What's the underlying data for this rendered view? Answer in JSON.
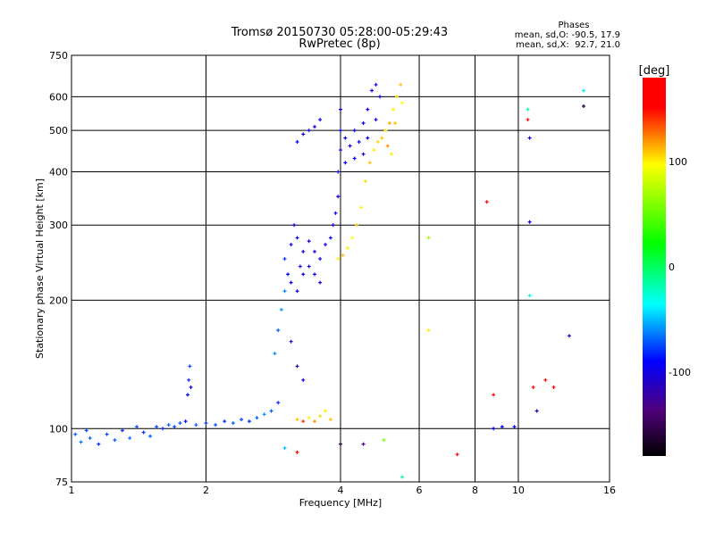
{
  "chart_data": {
    "type": "scatter",
    "title": "Tromsø 20150730 05:28:00-05:29:43",
    "subtitle": "RwPretec (8p)",
    "stats": {
      "heading": "Phases",
      "o_line": "mean, sd,O: -90.5, 17.9",
      "x_line": "mean, sd,X:  92.7, 21.0"
    },
    "xlabel": "Frequency [MHz]",
    "ylabel": "Stationary phase Virtual Height [km]",
    "xscale": "log",
    "yscale": "log",
    "xlim": [
      1,
      16
    ],
    "ylim": [
      75,
      750
    ],
    "xticks": [
      1,
      2,
      4,
      6,
      8,
      10,
      16
    ],
    "xtick_labels": [
      "1",
      "2",
      "4",
      "6",
      "8",
      "10",
      "16"
    ],
    "xgrid": [
      2,
      4,
      6,
      8,
      10
    ],
    "yticks": [
      75,
      100,
      200,
      300,
      400,
      500,
      600,
      750
    ],
    "ytick_labels": [
      "75",
      "100",
      "200",
      "300",
      "400",
      "500",
      "600",
      "750"
    ],
    "ygrid": [
      100,
      200,
      300,
      400,
      500,
      600
    ],
    "grid": true,
    "colorbar": {
      "label": "[deg]",
      "range": [
        -180,
        180
      ],
      "ticks": [
        100,
        0,
        -100
      ],
      "tick_labels": [
        "100",
        "0",
        "-100"
      ]
    },
    "point_format": [
      "frequency_MHz",
      "height_km",
      "phase_deg"
    ],
    "points": [
      [
        1.02,
        97,
        -70
      ],
      [
        1.05,
        93,
        -65
      ],
      [
        1.08,
        99,
        -75
      ],
      [
        1.1,
        95,
        -70
      ],
      [
        1.15,
        92,
        -80
      ],
      [
        1.2,
        97,
        -75
      ],
      [
        1.25,
        94,
        -70
      ],
      [
        1.3,
        99,
        -80
      ],
      [
        1.35,
        95,
        -70
      ],
      [
        1.4,
        101,
        -75
      ],
      [
        1.45,
        98,
        -80
      ],
      [
        1.5,
        96,
        -70
      ],
      [
        1.55,
        101,
        -75
      ],
      [
        1.6,
        100,
        -80
      ],
      [
        1.65,
        102,
        -70
      ],
      [
        1.7,
        101,
        -75
      ],
      [
        1.75,
        103,
        -70
      ],
      [
        1.8,
        104,
        -85
      ],
      [
        1.82,
        120,
        -90
      ],
      [
        1.83,
        130,
        -80
      ],
      [
        1.84,
        140,
        -75
      ],
      [
        1.85,
        125,
        -95
      ],
      [
        1.9,
        102,
        -70
      ],
      [
        2.0,
        103,
        -80
      ],
      [
        2.1,
        102,
        -75
      ],
      [
        2.2,
        104,
        -80
      ],
      [
        2.3,
        103,
        -70
      ],
      [
        2.4,
        105,
        -75
      ],
      [
        2.5,
        104,
        -80
      ],
      [
        2.6,
        106,
        -70
      ],
      [
        2.7,
        108,
        -60
      ],
      [
        2.8,
        110,
        -70
      ],
      [
        2.9,
        115,
        -80
      ],
      [
        2.85,
        150,
        -60
      ],
      [
        2.9,
        170,
        -70
      ],
      [
        2.95,
        190,
        -55
      ],
      [
        3.0,
        210,
        -60
      ],
      [
        3.0,
        250,
        -80
      ],
      [
        3.05,
        230,
        -90
      ],
      [
        3.1,
        270,
        -95
      ],
      [
        3.15,
        300,
        -100
      ],
      [
        3.2,
        280,
        -95
      ],
      [
        3.25,
        240,
        -100
      ],
      [
        3.3,
        260,
        -105
      ],
      [
        3.1,
        220,
        -90
      ],
      [
        3.2,
        210,
        -95
      ],
      [
        3.3,
        230,
        -100
      ],
      [
        3.4,
        240,
        -95
      ],
      [
        3.5,
        260,
        -100
      ],
      [
        3.6,
        250,
        -95
      ],
      [
        3.7,
        270,
        -100
      ],
      [
        3.8,
        280,
        -95
      ],
      [
        3.85,
        300,
        -100
      ],
      [
        3.9,
        320,
        -95
      ],
      [
        3.5,
        230,
        -100
      ],
      [
        3.6,
        220,
        -105
      ],
      [
        3.4,
        275,
        -100
      ],
      [
        3.2,
        140,
        -110
      ],
      [
        3.3,
        130,
        -100
      ],
      [
        3.1,
        160,
        -110
      ],
      [
        3.2,
        470,
        -95
      ],
      [
        3.3,
        490,
        -100
      ],
      [
        3.4,
        500,
        -95
      ],
      [
        3.5,
        510,
        -100
      ],
      [
        3.6,
        530,
        -95
      ],
      [
        3.95,
        350,
        -100
      ],
      [
        3.95,
        400,
        -95
      ],
      [
        4.0,
        450,
        -100
      ],
      [
        4.0,
        500,
        -95
      ],
      [
        4.0,
        560,
        -100
      ],
      [
        4.1,
        480,
        -95
      ],
      [
        4.2,
        460,
        -100
      ],
      [
        4.3,
        430,
        -95
      ],
      [
        4.4,
        470,
        -100
      ],
      [
        4.5,
        520,
        -95
      ],
      [
        4.6,
        560,
        -100
      ],
      [
        4.7,
        620,
        -95
      ],
      [
        4.8,
        640,
        -100
      ],
      [
        4.9,
        600,
        -95
      ],
      [
        4.5,
        440,
        -100
      ],
      [
        4.3,
        500,
        -95
      ],
      [
        4.1,
        420,
        -100
      ],
      [
        4.6,
        480,
        -95
      ],
      [
        4.8,
        530,
        -100
      ],
      [
        3.95,
        250,
        100
      ],
      [
        4.05,
        255,
        110
      ],
      [
        4.15,
        265,
        100
      ],
      [
        4.25,
        280,
        95
      ],
      [
        4.35,
        300,
        110
      ],
      [
        4.45,
        330,
        100
      ],
      [
        4.55,
        380,
        105
      ],
      [
        4.65,
        420,
        110
      ],
      [
        4.75,
        450,
        100
      ],
      [
        4.85,
        470,
        105
      ],
      [
        4.95,
        480,
        110
      ],
      [
        5.05,
        500,
        100
      ],
      [
        5.15,
        520,
        115
      ],
      [
        5.25,
        560,
        100
      ],
      [
        5.35,
        600,
        105
      ],
      [
        5.45,
        640,
        110
      ],
      [
        5.5,
        580,
        95
      ],
      [
        5.3,
        520,
        110
      ],
      [
        5.1,
        460,
        120
      ],
      [
        5.2,
        440,
        100
      ],
      [
        3.2,
        105,
        110
      ],
      [
        3.4,
        106,
        100
      ],
      [
        3.5,
        104,
        120
      ],
      [
        3.6,
        107,
        105
      ],
      [
        3.7,
        110,
        100
      ],
      [
        3.3,
        104,
        140
      ],
      [
        3.8,
        105,
        110
      ],
      [
        6.3,
        280,
        70
      ],
      [
        6.3,
        170,
        100
      ],
      [
        8.5,
        340,
        150
      ],
      [
        8.8,
        120,
        150
      ],
      [
        7.3,
        87,
        170
      ],
      [
        8.8,
        100,
        -90
      ],
      [
        9.2,
        101,
        -90
      ],
      [
        9.8,
        101,
        -90
      ],
      [
        10.5,
        560,
        -20
      ],
      [
        10.5,
        530,
        150
      ],
      [
        10.6,
        480,
        -100
      ],
      [
        10.6,
        305,
        -100
      ],
      [
        10.6,
        205,
        -30
      ],
      [
        10.8,
        125,
        150
      ],
      [
        11,
        110,
        -110
      ],
      [
        11.5,
        130,
        160
      ],
      [
        12,
        125,
        150
      ],
      [
        13,
        165,
        -110
      ],
      [
        14,
        620,
        -40
      ],
      [
        14,
        570,
        -160
      ],
      [
        3.2,
        88,
        170
      ],
      [
        3.0,
        90,
        -50
      ],
      [
        4.5,
        92,
        -130
      ],
      [
        5.0,
        94,
        60
      ],
      [
        5.5,
        77,
        -20
      ],
      [
        4.0,
        92,
        -160
      ]
    ]
  }
}
